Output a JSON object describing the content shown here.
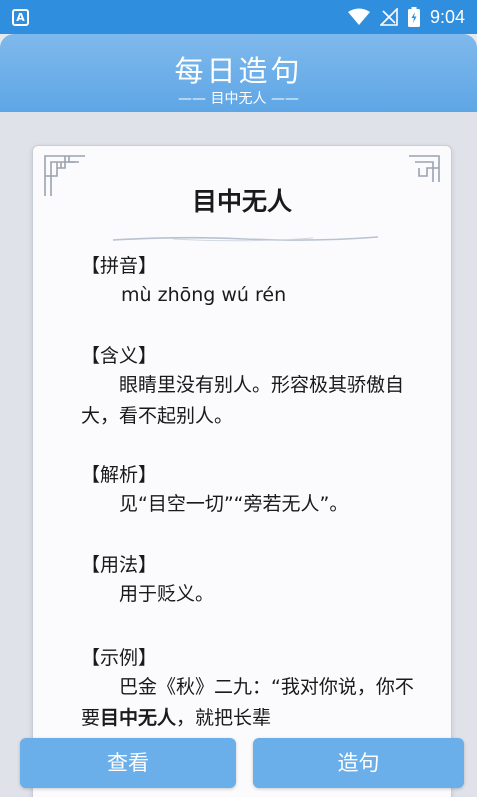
{
  "status_bar": {
    "app_icon_letter": "A",
    "time": "9:04"
  },
  "header": {
    "title": "每日造句",
    "subtitle": "—— 目中无人 ——"
  },
  "card": {
    "word": "目中无人",
    "pinyin_label": "【拼音】",
    "pinyin": "mù zhōng wú rén",
    "meaning_label": "【含义】",
    "meaning": "眼睛里没有别人。形容极其骄傲自大，看不起别人。",
    "analysis_label": "【解析】",
    "analysis": "见“目空一切”“旁若无人”。",
    "usage_label": "【用法】",
    "usage": "用于贬义。",
    "example_label": "【示例】",
    "example_pre": "巴金《秋》二九：“我对你说，你不要",
    "example_bold": "目中无人",
    "example_post": "，就把长辈"
  },
  "buttons": {
    "view": "查看",
    "make_sentence": "造句"
  }
}
